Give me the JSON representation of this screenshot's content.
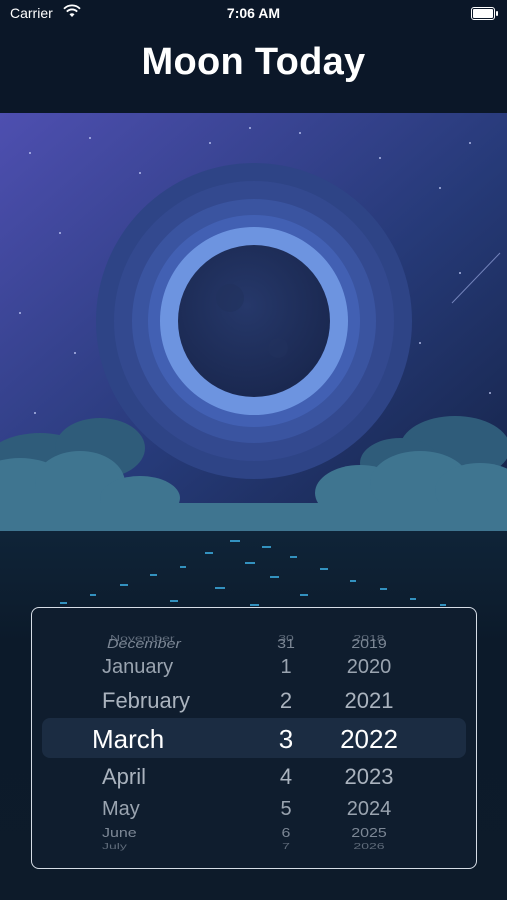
{
  "status_bar": {
    "carrier": "Carrier",
    "time": "7:06 AM"
  },
  "nav": {
    "title": "Moon Today"
  },
  "picker": {
    "months": [
      "November",
      "December",
      "January",
      "February",
      "March",
      "April",
      "May",
      "June",
      "July"
    ],
    "days": [
      "30",
      "31",
      "1",
      "2",
      "3",
      "4",
      "5",
      "6",
      "7"
    ],
    "years": [
      "2018",
      "2019",
      "2020",
      "2021",
      "2022",
      "2023",
      "2024",
      "2025",
      "2026"
    ],
    "selected": {
      "month": "March",
      "day": "3",
      "year": "2022"
    }
  },
  "colors": {
    "sky_top": "#4a4fa8",
    "sky_bottom": "#1a2a5a",
    "moon_ring": "#5b86d8",
    "cloud": "#3d6e8a"
  }
}
